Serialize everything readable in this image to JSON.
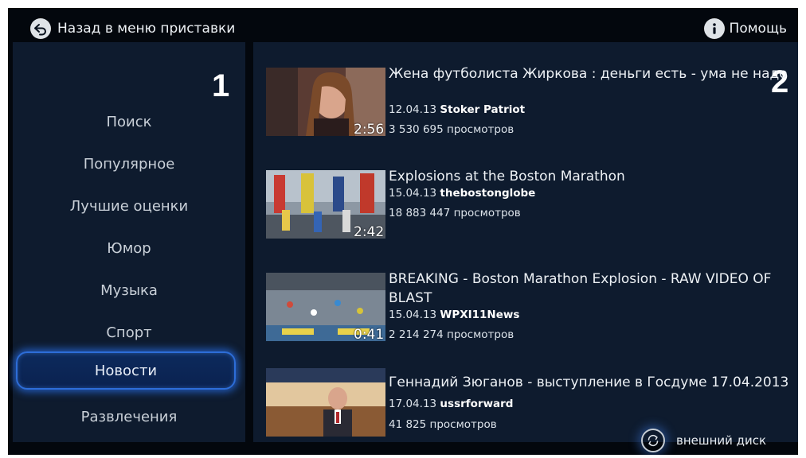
{
  "topbar": {
    "back_label": "Назад в меню приставки",
    "help_label": "Помощь",
    "back_icon": "back-arrow-icon",
    "help_icon": "info-icon"
  },
  "left_panel": {
    "number": "1",
    "menu": [
      {
        "label": "Поиск",
        "active": false
      },
      {
        "label": "Популярное",
        "active": false
      },
      {
        "label": "Лучшие оценки",
        "active": false
      },
      {
        "label": "Юмор",
        "active": false
      },
      {
        "label": "Музыка",
        "active": false
      },
      {
        "label": "Спорт",
        "active": false
      },
      {
        "label": "Новости",
        "active": true
      },
      {
        "label": "Развлечения",
        "active": false
      }
    ]
  },
  "right_panel": {
    "number": "2",
    "videos": [
      {
        "title": "Жена футболиста Жиркова : деньги есть - ума не надо",
        "date": "12.04.13",
        "author": "Stoker Patriot",
        "views": "3 530 695 просмотров",
        "duration": "2:56"
      },
      {
        "title": "Explosions at the Boston Marathon",
        "date": "15.04.13",
        "author": "thebostonglobe",
        "views": "18 883 447 просмотров",
        "duration": "2:42"
      },
      {
        "title": "BREAKING - Boston Marathon Explosion - RAW VIDEO OF BLAST",
        "date": "15.04.13",
        "author": "WPXI11News",
        "views": "2 214 274 просмотров",
        "duration": "0:41"
      },
      {
        "title": "Геннадий Зюганов - выступление в Госдуме 17.04.2013",
        "date": "17.04.13",
        "author": "ussrforward",
        "views": "41 825 просмотров",
        "duration": ""
      }
    ]
  },
  "footer": {
    "external_disk_label": "внешний диск",
    "external_disk_icon": "refresh-icon"
  },
  "colors": {
    "background": "#03070d",
    "panel": "#0e1b2e",
    "active_glow": "#2d6dd8",
    "text": "#e9edf2"
  }
}
